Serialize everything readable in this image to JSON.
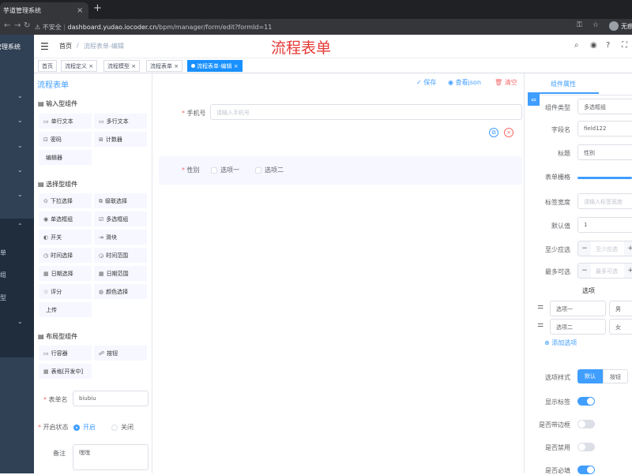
{
  "browser": {
    "tab_title": "芋道管理系统",
    "tab_close": "×",
    "new_tab": "+",
    "not_secure": "不安全",
    "url_host": "dashboard.yudao.iocoder.cn",
    "url_path": "/bpm/manager/form/edit?formId=11",
    "profile_label": "无痕"
  },
  "sidebar": {
    "title": "芋道管理系统",
    "sub_items": [
      "流程表单",
      "用户分组",
      "流程模型"
    ]
  },
  "navbar": {
    "breadcrumb": [
      "首页",
      "流程表单-编辑"
    ],
    "separator": "/",
    "overlay_title": "流程表单"
  },
  "tags": [
    "首页",
    "流程定义",
    "流程模型",
    "流程表单",
    "流程表单-编辑"
  ],
  "designer": {
    "left_title": "流程表单",
    "groups": [
      {
        "title": "输入型组件",
        "icon": "list-icon",
        "items": [
          {
            "label": "单行文本",
            "icon": "input-icon"
          },
          {
            "label": "多行文本",
            "icon": "textarea-icon"
          },
          {
            "label": "密码",
            "icon": "password-icon"
          },
          {
            "label": "计数器",
            "icon": "number-icon"
          },
          {
            "label": "编辑器",
            "icon": "editor-icon"
          }
        ]
      },
      {
        "title": "选择型组件",
        "icon": "list-icon",
        "items": [
          {
            "label": "下拉选择",
            "icon": "select-icon"
          },
          {
            "label": "级联选择",
            "icon": "cascader-icon"
          },
          {
            "label": "单选框组",
            "icon": "radio-icon"
          },
          {
            "label": "多选框组",
            "icon": "checkbox-icon"
          },
          {
            "label": "开关",
            "icon": "switch-icon"
          },
          {
            "label": "滑块",
            "icon": "slider-icon"
          },
          {
            "label": "时间选择",
            "icon": "time-icon"
          },
          {
            "label": "时间范围",
            "icon": "time-range-icon"
          },
          {
            "label": "日期选择",
            "icon": "date-icon"
          },
          {
            "label": "日期范围",
            "icon": "date-range-icon"
          },
          {
            "label": "评分",
            "icon": "rate-icon"
          },
          {
            "label": "颜色选择",
            "icon": "color-icon"
          },
          {
            "label": "上传",
            "icon": "upload-icon"
          }
        ]
      },
      {
        "title": "布局型组件",
        "icon": "list-icon",
        "items": [
          {
            "label": "行容器",
            "icon": "row-icon"
          },
          {
            "label": "按钮",
            "icon": "button-icon"
          },
          {
            "label": "表格[开发中]",
            "icon": "table-icon"
          }
        ]
      }
    ],
    "form_name_label": "表单名",
    "form_name_value": "biubiu",
    "status_label": "开启状态",
    "status_on": "开启",
    "status_off": "关闭",
    "remark_label": "备注",
    "remark_value": "嘿嘿",
    "toolbar": {
      "save": "保存",
      "view_json": "查看json",
      "clear": "清空"
    },
    "canvas": {
      "phone_label": "手机号",
      "phone_placeholder": "请输入手机号",
      "gender_label": "性别",
      "options": [
        "选项一",
        "选项二"
      ]
    }
  },
  "props": {
    "tab": "组件属性",
    "type_label": "组件类型",
    "type_value": "多选框组",
    "field_label": "字段名",
    "field_value": "field122",
    "title_label": "标题",
    "title_value": "性别",
    "grid_label": "表单栅格",
    "label_width_label": "标签宽度",
    "label_width_placeholder": "请输入标签宽度",
    "default_label": "默认值",
    "default_value": "1",
    "min_label": "至少应选",
    "min_placeholder": "至少应选",
    "max_label": "最多可选",
    "max_placeholder": "最多可选",
    "options_header": "选项",
    "options": [
      {
        "label": "选项一",
        "value": "男"
      },
      {
        "label": "选项二",
        "value": "女"
      }
    ],
    "add_option": "添加选项",
    "style_label": "选项样式",
    "style_default": "默认",
    "style_button": "按钮",
    "show_label_label": "显示标签",
    "border_label": "是否带边框",
    "disabled_label": "是否禁用",
    "required_label": "是否必填",
    "switches": {
      "show_label": true,
      "border": false,
      "disabled": false,
      "required": true
    },
    "accent": "#409eff"
  }
}
